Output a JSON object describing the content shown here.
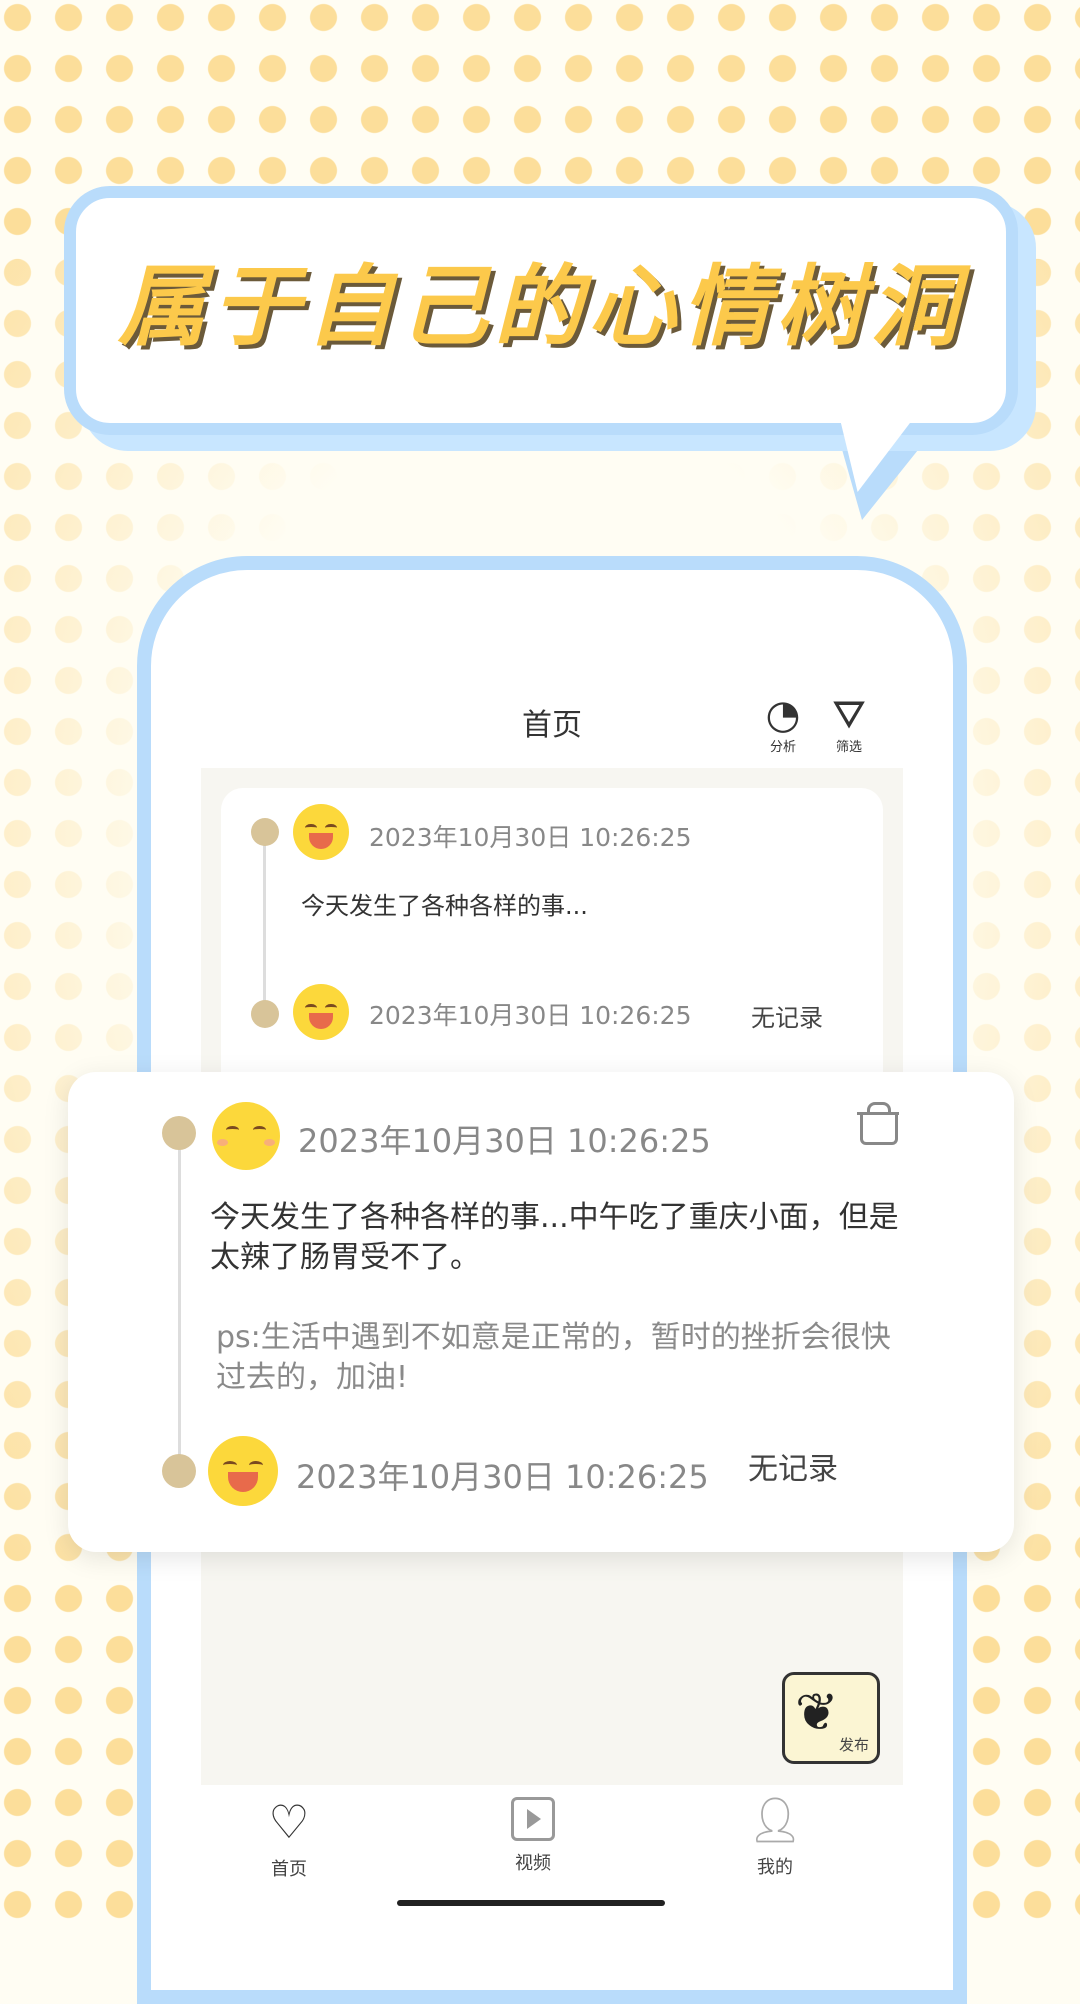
{
  "promo": {
    "headline": "属于自己的心情树洞",
    "colors": {
      "accent_yellow": "#fcc94b",
      "frame_blue": "#b9dcfb",
      "dot_yellow": "#fcd98a"
    }
  },
  "nav": {
    "title": "首页",
    "analysis_label": "分析",
    "filter_label": "筛选"
  },
  "inner_entry": {
    "date1": "2023年10月30日 10:26:25",
    "text": "今天发生了各种各样的事...",
    "date2": "2023年10月30日 10:26:25",
    "no_record": "无记录"
  },
  "featured_entry": {
    "date1": "2023年10月30日 10:26:25",
    "text_line1": "今天发生了各种各样的事...中午吃了重庆小面，但是",
    "text_line2": "太辣了肠胃受不了。",
    "ps_line1": "ps:生活中遇到不如意是正常的，暂时的挫折会很快",
    "ps_line2": "过去的，加油!",
    "date2": "2023年10月30日 10:26:25",
    "no_record": "无记录"
  },
  "fab": {
    "label": "发布"
  },
  "tabbar": {
    "home": "首页",
    "video": "视频",
    "mine": "我的"
  }
}
